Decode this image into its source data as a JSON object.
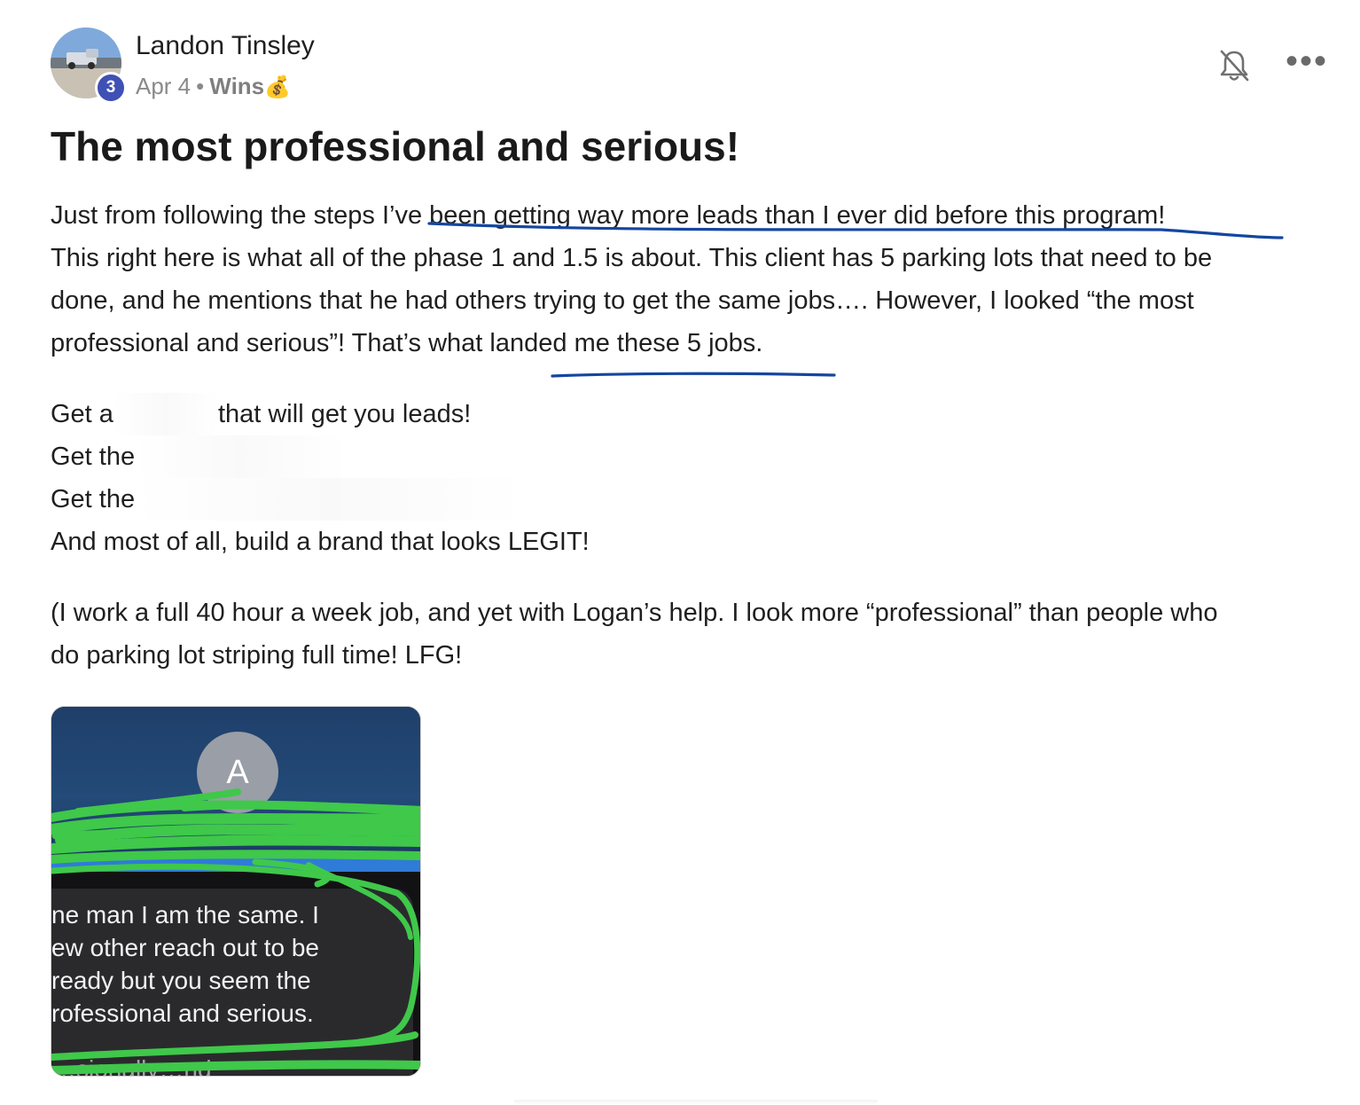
{
  "post": {
    "author": "Landon Tinsley",
    "level": "3",
    "date": "Apr 4",
    "separator": "•",
    "category": "Wins",
    "category_emoji": "💰",
    "title": "The most professional and serious!",
    "paragraph1": [
      "Just from following the steps I’ve been getting way more leads than I ever did before this program!",
      "This right here is what all of the phase 1 and 1.5 is about. This client has 5 parking lots that need to be",
      "done, and he mentions that he had others trying to get the same jobs…. However, I looked “the most",
      "professional and serious”! That’s what landed me these 5 jobs."
    ],
    "paragraph2": {
      "line1_start": "Get a",
      "line1_end": "that will get you leads!",
      "line2_start": "Get the",
      "line3_start": "Get the",
      "line4": "And most of all, build a brand that looks LEGIT!"
    },
    "paragraph3": [
      "(I work a full 40 hour a week job, and yet with Logan’s help. I look more “professional” than people who",
      "do parking lot striping full time! LFG!"
    ]
  },
  "actions": {
    "bell_icon": "bell-off-icon",
    "more_icon": "more-horizontal-icon",
    "more_label": "•••"
  },
  "attachment": {
    "avatar_letter": "A",
    "message_lines": [
      "ne man I am the same. I",
      "ew other reach out to be",
      "ready but you seem the",
      "rofessional and serious."
    ],
    "cut_off_line": "…sionally…nd"
  },
  "colors": {
    "underline_ink": "#1446a0",
    "scribble": "#3fc84a",
    "level_badge": "#3f51b5"
  }
}
